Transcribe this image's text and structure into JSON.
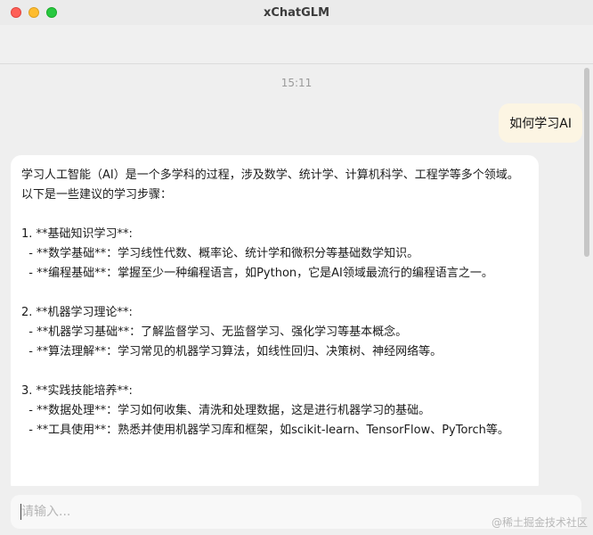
{
  "window": {
    "title": "xChatGLM"
  },
  "chat": {
    "timestamp": "15:11",
    "user_message": "如何学习AI",
    "assistant_message": "学习人工智能（AI）是一个多学科的过程，涉及数学、统计学、计算机科学、工程学等多个领域。以下是一些建议的学习步骤：\n\n1. **基础知识学习**:\n  - **数学基础**：学习线性代数、概率论、统计学和微积分等基础数学知识。\n  - **编程基础**：掌握至少一种编程语言，如Python，它是AI领域最流行的编程语言之一。\n\n2. **机器学习理论**:\n  - **机器学习基础**：了解监督学习、无监督学习、强化学习等基本概念。\n  - **算法理解**：学习常见的机器学习算法，如线性回归、决策树、神经网络等。\n\n3. **实践技能培养**:\n  - **数据处理**：学习如何收集、清洗和处理数据，这是进行机器学习的基础。\n  - **工具使用**：熟悉并使用机器学习库和框架，如scikit-learn、TensorFlow、PyTorch等。"
  },
  "input": {
    "placeholder": "请输入..."
  },
  "watermark": "@稀土掘金技术社区",
  "colors": {
    "user_bubble": "#fcf5e3",
    "assistant_bubble": "#ffffff",
    "background": "#efefef"
  }
}
